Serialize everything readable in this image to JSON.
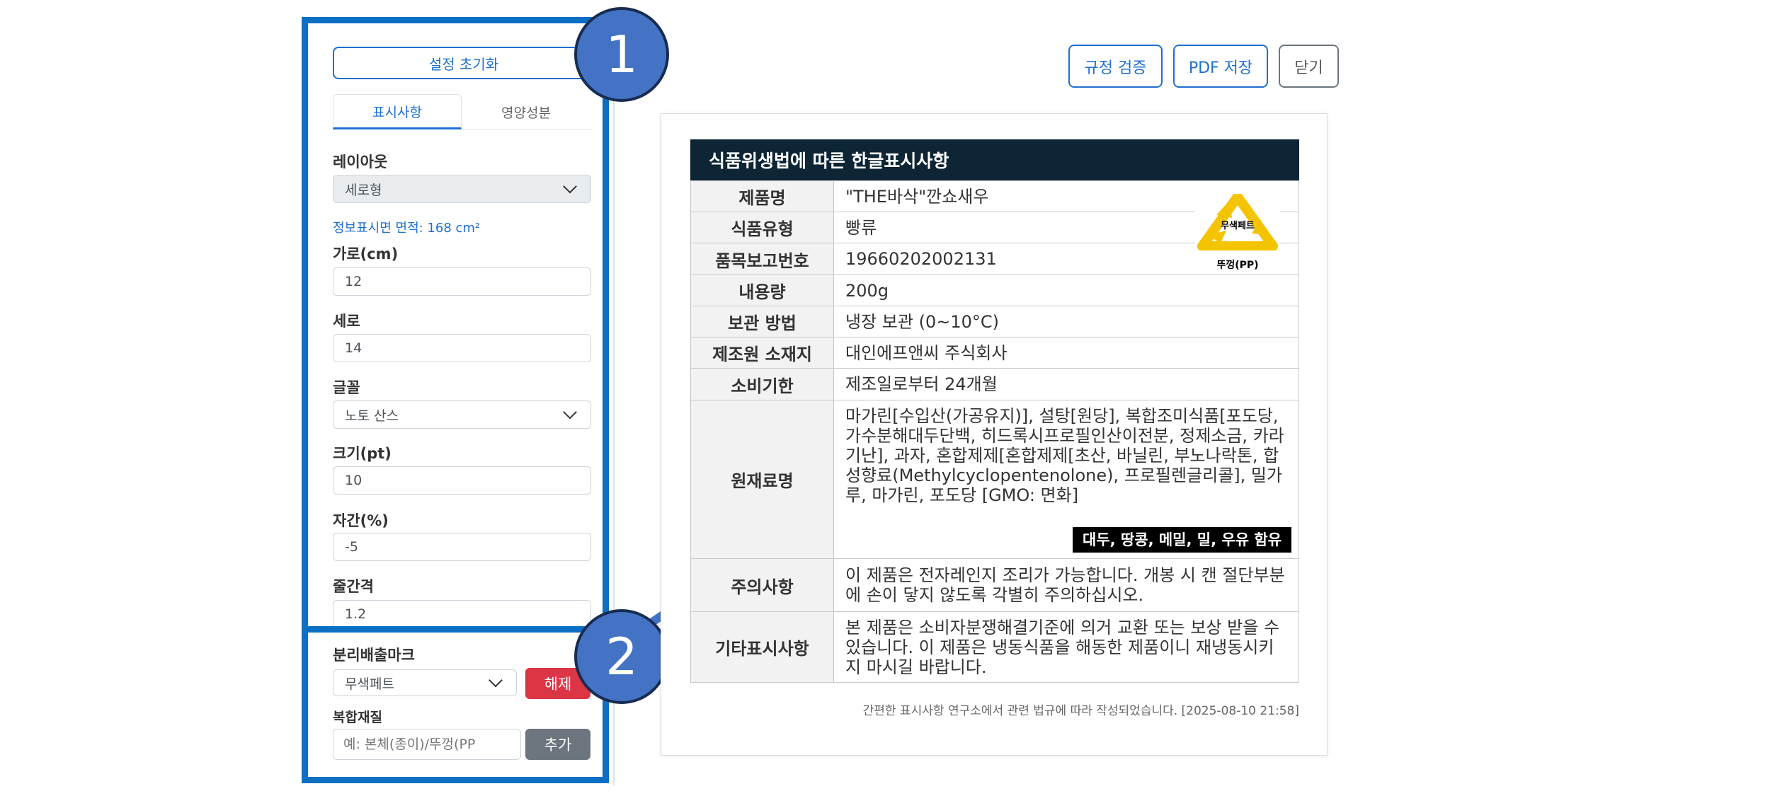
{
  "panel": {
    "reset_label": "설정 초기화",
    "tabs": [
      {
        "label": "표시사항",
        "active": true
      },
      {
        "label": "영양성분",
        "active": false
      }
    ],
    "layout_label": "레이아웃",
    "layout_value": "세로형",
    "area_text": "정보표시면 면적: 168 cm²",
    "width_label": "가로(cm)",
    "width_value": "12",
    "height_label": "세로",
    "height_value": "14",
    "font_label": "글꼴",
    "font_value": "노토 산스",
    "size_label": "크기(pt)",
    "size_value": "10",
    "spacing_label": "자간(%)",
    "spacing_value": "-5",
    "linegap_label": "줄간격",
    "linegap_value": "1.2",
    "recycle_label": "분리배출마크",
    "recycle_value": "무색페트",
    "release_label": "해제",
    "composite_label": "복합재질",
    "composite_placeholder": "예: 본체(종이)/뚜껑(PP",
    "add_label": "추가"
  },
  "toolbar": {
    "verify_label": "규정 검증",
    "pdf_label": "PDF 저장",
    "close_label": "닫기"
  },
  "label": {
    "header": "식품위생법에 따른 한글표시사항",
    "recycle_mark_text": "무색페트",
    "recycle_caption": "뚜껑(PP)",
    "rows": [
      {
        "key": "제품명",
        "value": "\"THE바삭\"깐쇼새우"
      },
      {
        "key": "식품유형",
        "value": "빵류"
      },
      {
        "key": "품목보고번호",
        "value": "19660202002131"
      },
      {
        "key": "내용량",
        "value": "200g"
      },
      {
        "key": "보관 방법",
        "value": "냉장 보관 (0~10°C)"
      },
      {
        "key": "제조원 소재지",
        "value": "대인에프앤씨 주식회사"
      },
      {
        "key": "소비기한",
        "value": "제조일로부터 24개월"
      },
      {
        "key": "원재료명",
        "value": "마가린[수입산(가공유지)], 설탕[원당], 복합조미식품[포도당, 가수분해대두단백, 히드록시프로필인산이전분, 정제소금, 카라기난], 과자, 혼합제제[혼합제제[초산, 바닐린, 부노나락톤, 합성향료(Methylcyclopentenolone), 프로필렌글리콜], 밀가루, 마가린, 포도당 [GMO: 면화]"
      },
      {
        "key": "주의사항",
        "value": "이 제품은 전자레인지 조리가 가능합니다. 개봉 시 캔 절단부분에 손이 닿지 않도록 각별히 주의하십시오."
      },
      {
        "key": "기타표시사항",
        "value": "본 제품은 소비자분쟁해결기준에 의거 교환 또는 보상 받을 수 있습니다. 이 제품은 냉동식품을 해동한 제품이니 재냉동시키지 마시길 바랍니다."
      }
    ],
    "allergen": "대두, 땅콩, 메밀, 밀, 우유 함유",
    "footer": "간편한 표시사항 연구소에서 관련 법규에 따라 작성되었습니다. [2025-08-10 21:58]"
  },
  "callouts": [
    {
      "label": "1"
    },
    {
      "label": "2"
    }
  ],
  "colors": {
    "accent": "#1f6fd1",
    "frame": "#0b6fc4",
    "circle": "#4472c4",
    "danger": "#dc3545",
    "header_bg": "#0d2535"
  }
}
